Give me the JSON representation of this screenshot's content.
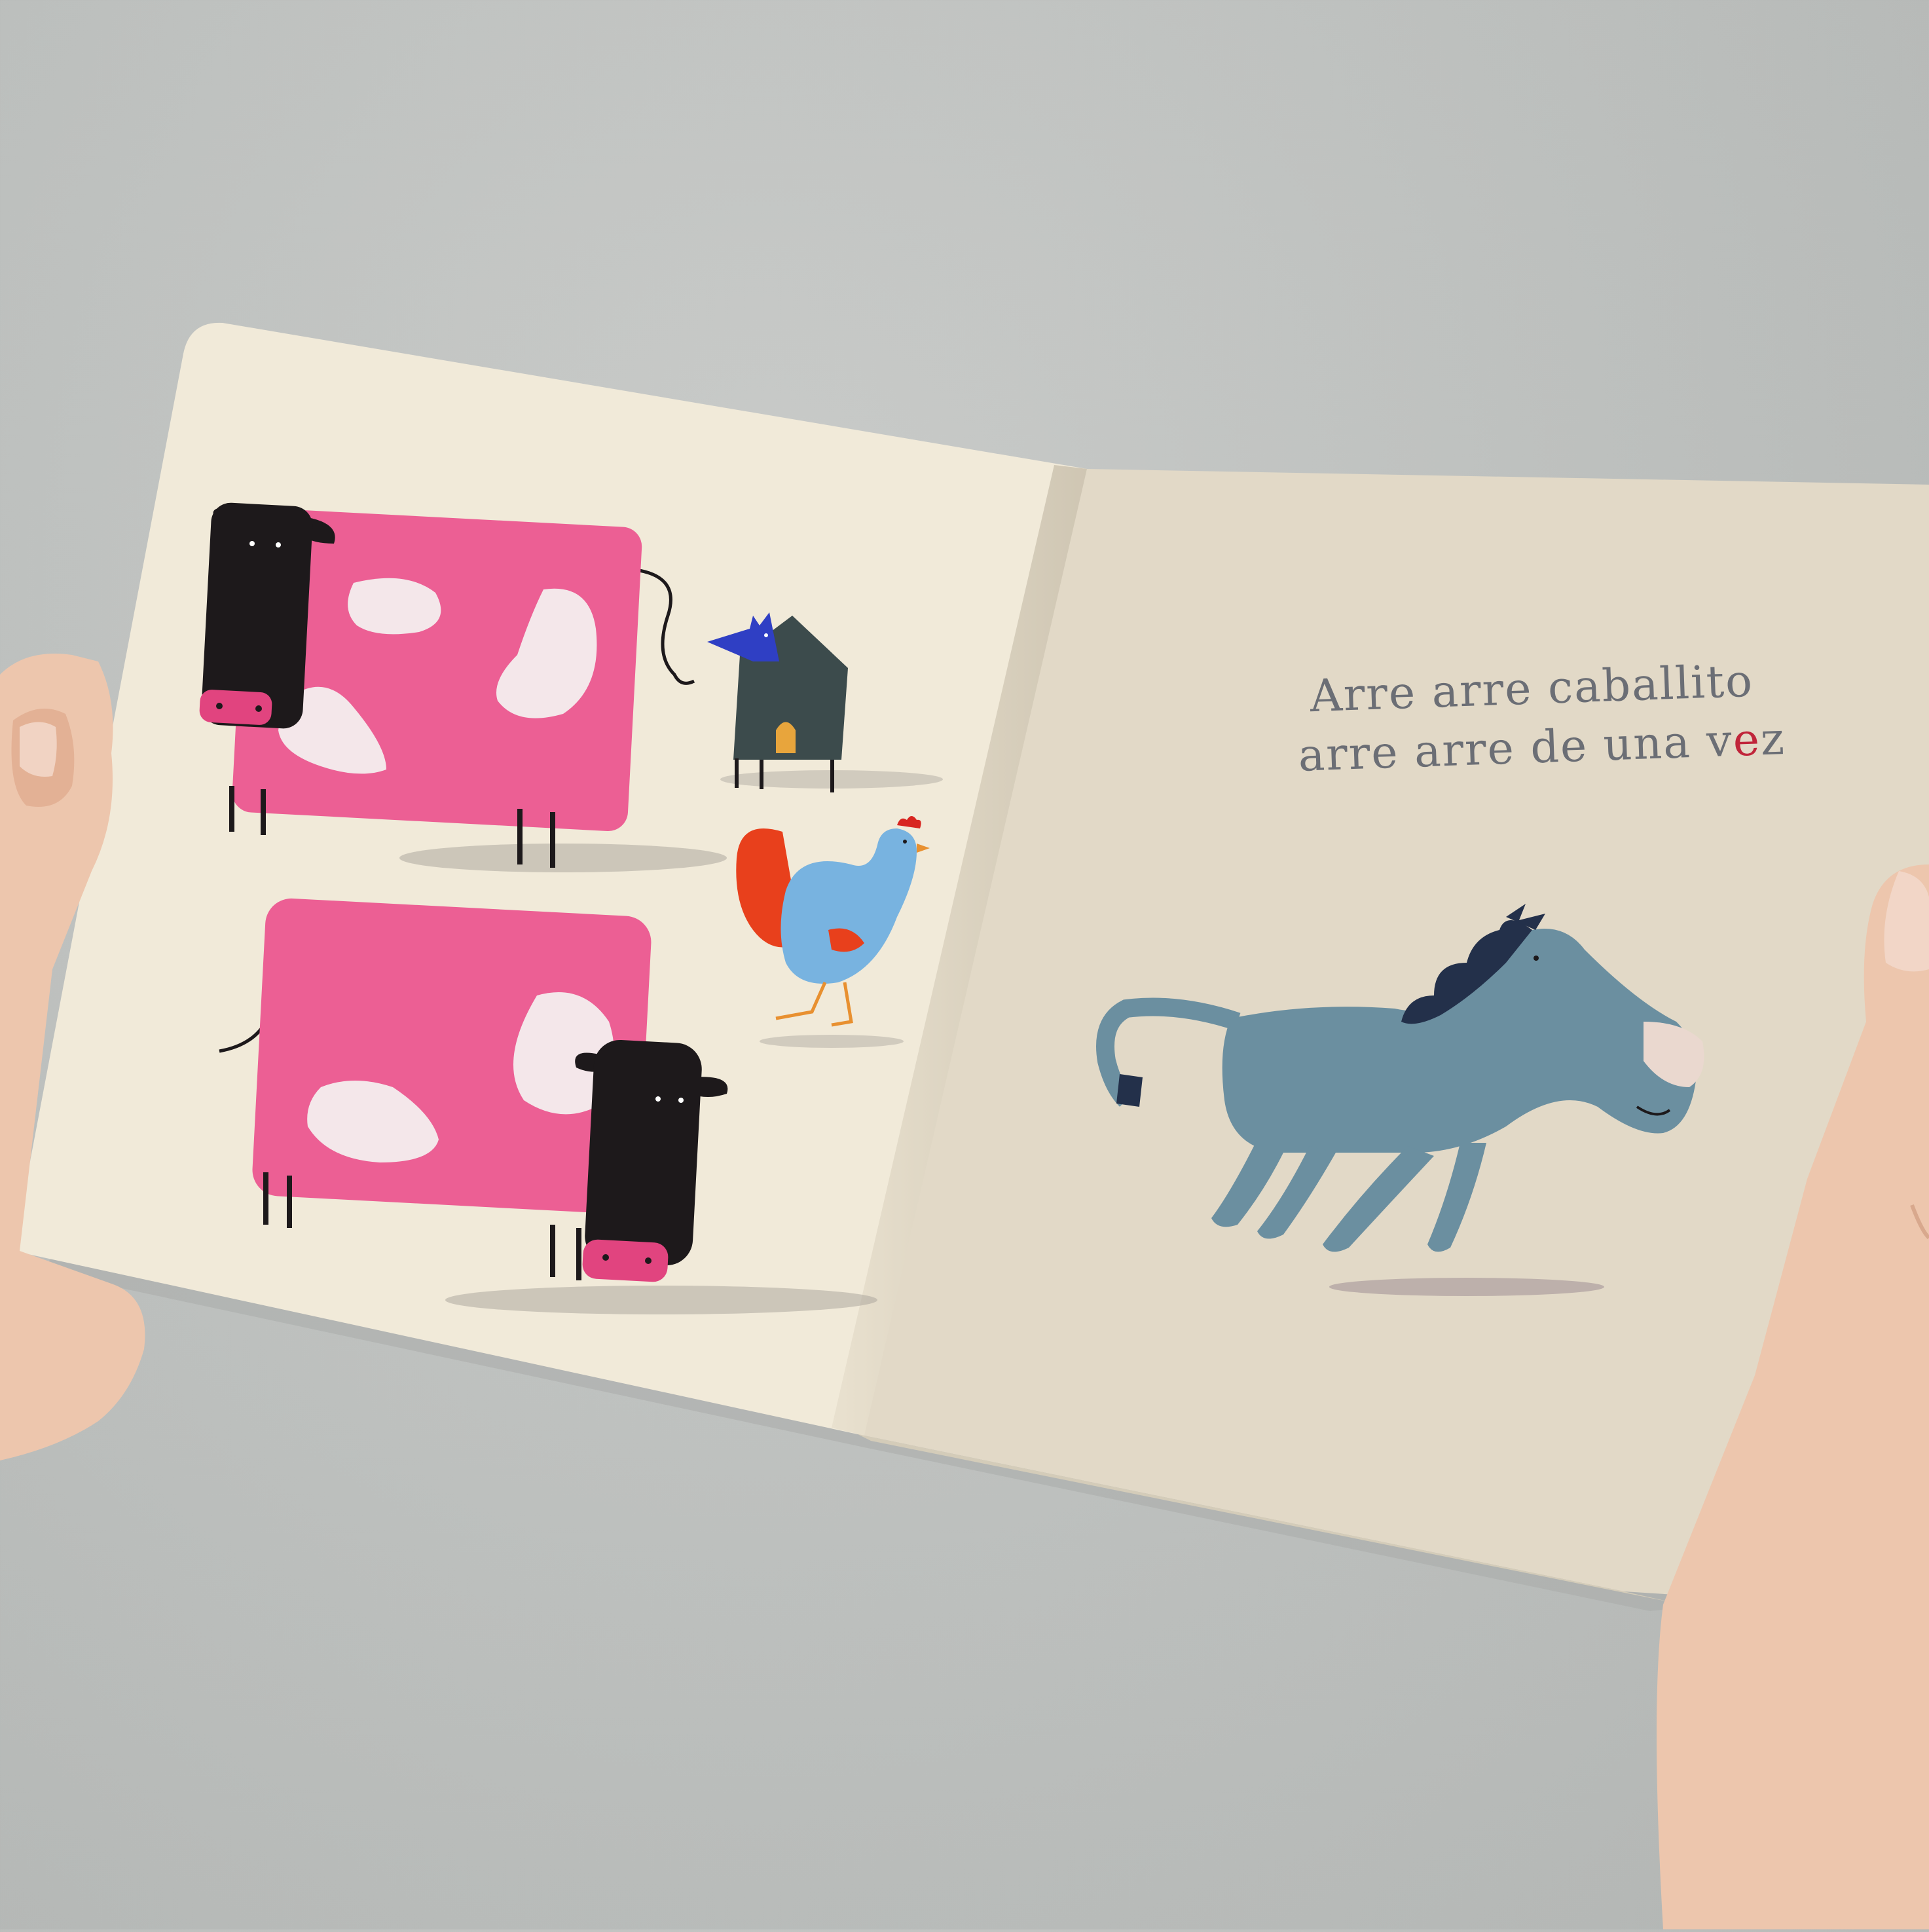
{
  "book": {
    "text_line_1": "Arre arre caballito",
    "text_line_2_prefix": "arre arre de una v",
    "text_line_2_accent": "e",
    "text_line_2_suffix": "z"
  },
  "colors": {
    "wall": "#bfc2c0",
    "left_page": "#f1ead9",
    "right_page": "#e2d9c7",
    "cow_body": "#ec5f94",
    "cow_head": "#1d191b",
    "horse": "#6b8fa0",
    "rooster_body": "#78b3e0",
    "rooster_tail": "#e8401c",
    "text": "#6b6e75",
    "text_accent": "#c0253a",
    "skin": "#edc6ad"
  },
  "icons": [
    "cow",
    "cow",
    "fox-in-doghouse",
    "rooster",
    "horse",
    "hand",
    "hand"
  ]
}
